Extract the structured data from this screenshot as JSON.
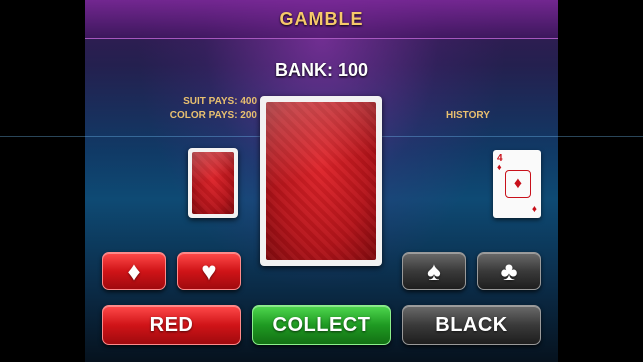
{
  "header": {
    "title": "GAMBLE"
  },
  "bank": {
    "label": "BANK: 100"
  },
  "payouts": {
    "suit_pays": "SUIT PAYS: 400",
    "color_pays": "COLOR PAYS: 200"
  },
  "history": {
    "label": "HISTORY",
    "last_card": {
      "rank": "4",
      "suit": "♦",
      "suit_name": "diamonds",
      "color": "#c8101a"
    }
  },
  "suit_buttons": [
    {
      "name": "diamond",
      "glyph": "♦"
    },
    {
      "name": "heart",
      "glyph": "♥"
    },
    {
      "name": "spade",
      "glyph": "♠"
    },
    {
      "name": "club",
      "glyph": "♣"
    }
  ],
  "action_buttons": {
    "red": "RED",
    "collect": "COLLECT",
    "black": "BLACK"
  },
  "colors": {
    "accent_gold": "#f7c96a",
    "red_button": "#d01418",
    "green_button": "#1f9a22",
    "dark_button": "#3a3a3a"
  }
}
